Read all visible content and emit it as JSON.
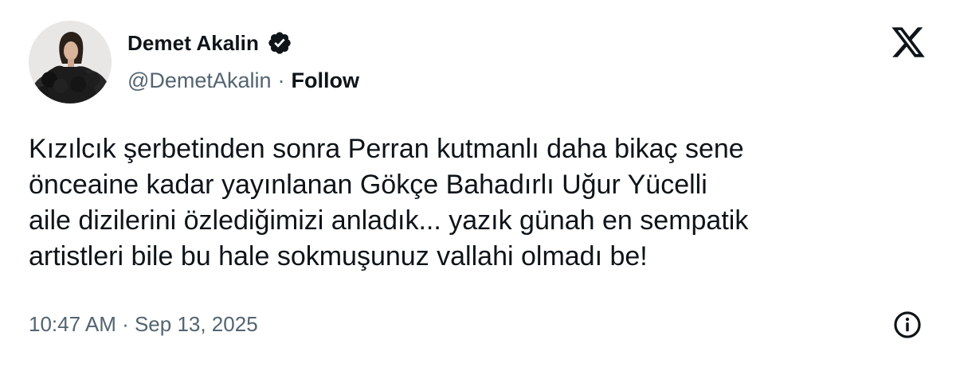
{
  "author": {
    "display_name": "Demet Akalin",
    "handle": "@DemetAkalin",
    "separator": "·",
    "follow_label": "Follow",
    "verified": true
  },
  "tweet": {
    "text": "Kızılcık şerbetinden sonra  Perran kutmanlı daha bikaç sene\nönceaine kadar yayınlanan Gökçe Bahadırlı Uğur Yücelli\naile dizilerini özlediğimizi anladık... yazık günah en sempatik\nartistleri bile bu hale sokmuşunuz vallahi olmadı be!",
    "timestamp": "10:47 AM · Sep 13, 2025"
  },
  "icons": {
    "platform_logo": "x-logo-icon",
    "verified": "verified-badge-icon",
    "info": "info-icon"
  },
  "colors": {
    "text_primary": "#0f1419",
    "text_secondary": "#536471",
    "background": "#ffffff"
  }
}
